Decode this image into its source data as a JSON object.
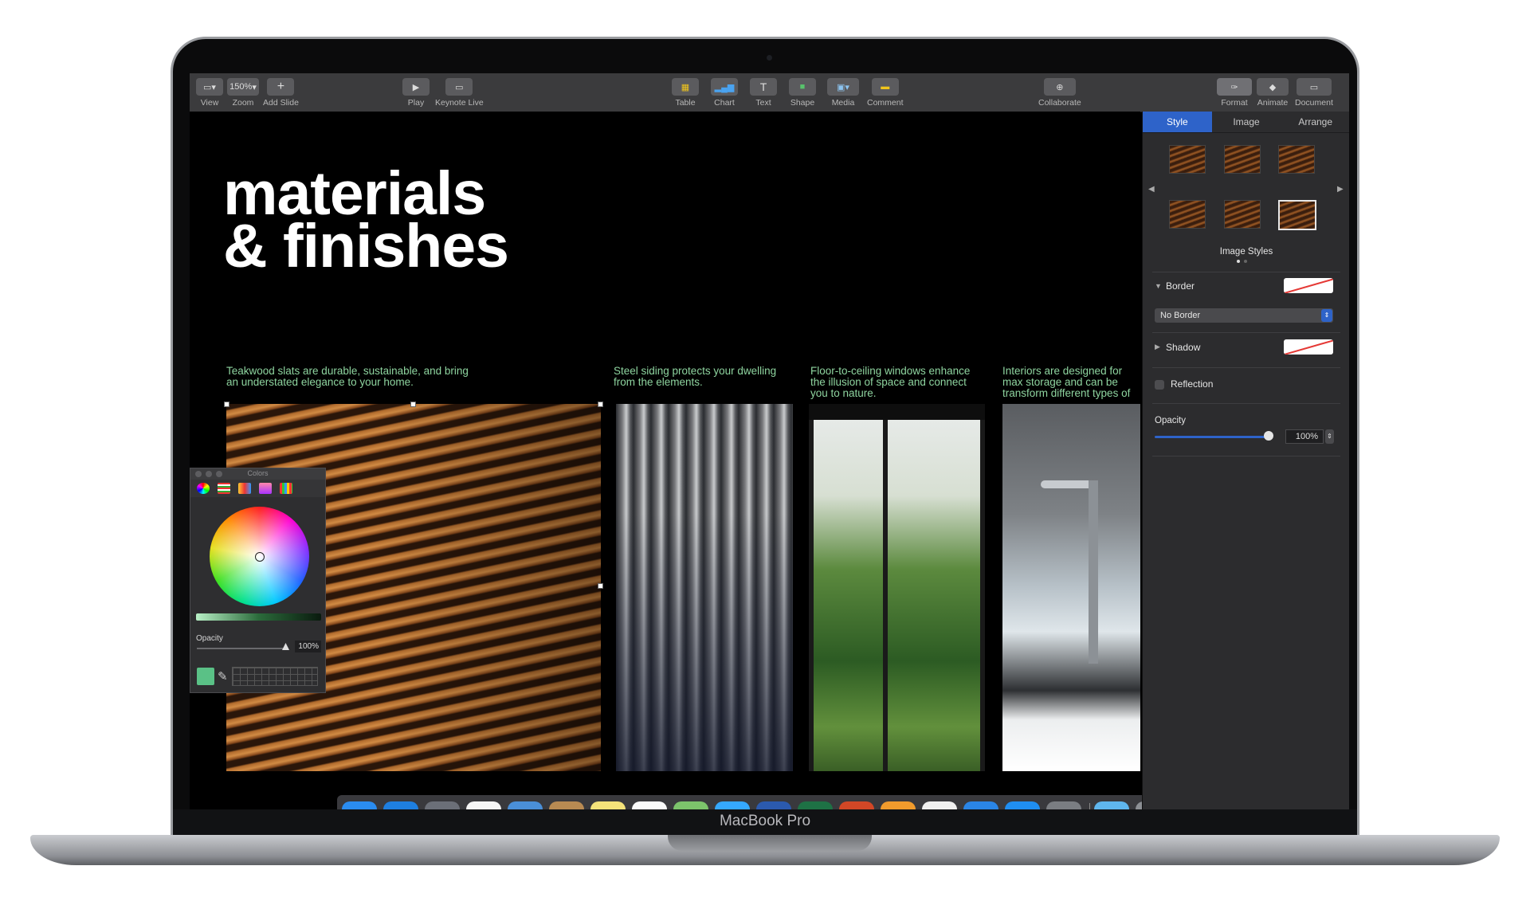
{
  "device_label": "MacBook Pro",
  "toolbar": {
    "left": [
      {
        "icon": "view-icon",
        "label": "View"
      },
      {
        "icon": "zoom-select",
        "value": "150%",
        "label": "Zoom"
      },
      {
        "icon": "plus-icon",
        "label": "Add Slide"
      }
    ],
    "play": [
      {
        "icon": "play-icon",
        "label": "Play"
      },
      {
        "icon": "keynote-live-icon",
        "label": "Keynote Live"
      }
    ],
    "insert": [
      {
        "icon": "table-icon",
        "label": "Table"
      },
      {
        "icon": "chart-icon",
        "label": "Chart"
      },
      {
        "icon": "text-icon",
        "label": "Text"
      },
      {
        "icon": "shape-icon",
        "label": "Shape"
      },
      {
        "icon": "media-icon",
        "label": "Media"
      },
      {
        "icon": "comment-icon",
        "label": "Comment"
      }
    ],
    "collaborate": {
      "icon": "collaborate-icon",
      "label": "Collaborate"
    },
    "right": [
      {
        "icon": "format-icon",
        "label": "Format"
      },
      {
        "icon": "animate-icon",
        "label": "Animate"
      },
      {
        "icon": "document-icon",
        "label": "Document"
      }
    ]
  },
  "slide": {
    "title_line1": "materials",
    "title_line2": "& finishes",
    "captions": [
      "Teakwood slats are durable, sustainable, and bring an understated elegance to your home.",
      "Steel siding protects your dwelling from the elements.",
      "Floor-to-ceiling windows enhance the illusion of space and connect you to nature.",
      "Interiors are designed for max storage and can be transform different types of spaces."
    ]
  },
  "inspector": {
    "tabs": [
      "Style",
      "Image",
      "Arrange"
    ],
    "selected_tab": "Style",
    "image_styles_label": "Image Styles",
    "border_label": "Border",
    "border_select": "No Border",
    "shadow_label": "Shadow",
    "reflection_label": "Reflection",
    "opacity_label": "Opacity",
    "opacity_value": "100%",
    "opacity_level": 1.0
  },
  "colors_panel": {
    "title": "Colors",
    "opacity_label": "Opacity",
    "opacity_value": "100%",
    "selected_color": "#5ac186"
  },
  "dock": {
    "apps": [
      {
        "name": "finder-icon",
        "glyph": "☺",
        "color": "#2a8cf0",
        "running": true
      },
      {
        "name": "safari-icon",
        "glyph": "⊕",
        "color": "#1e7fe0",
        "running": false
      },
      {
        "name": "launchpad-icon",
        "glyph": "➶",
        "color": "#6b6f78",
        "running": false
      },
      {
        "name": "photos-icon",
        "glyph": "✿",
        "color": "#f5f5f5",
        "running": false
      },
      {
        "name": "mail-icon",
        "glyph": "✉",
        "color": "#4a8fd8",
        "running": false
      },
      {
        "name": "contacts-icon",
        "glyph": "☗",
        "color": "#b88a52",
        "running": false
      },
      {
        "name": "notes-icon",
        "glyph": "✎",
        "color": "#f4e27a",
        "running": false
      },
      {
        "name": "reminders-icon",
        "glyph": "☰",
        "color": "#fafafa",
        "running": false
      },
      {
        "name": "maps-icon",
        "glyph": "⌖",
        "color": "#7cc36b",
        "running": false
      },
      {
        "name": "messages-icon",
        "glyph": "✆",
        "color": "#35a8ff",
        "running": false
      },
      {
        "name": "word-icon",
        "glyph": "W",
        "color": "#2b5aae",
        "running": false
      },
      {
        "name": "excel-icon",
        "glyph": "X",
        "color": "#1e7145",
        "running": false
      },
      {
        "name": "powerpoint-icon",
        "glyph": "P",
        "color": "#d24726",
        "running": false
      },
      {
        "name": "pages-icon",
        "glyph": "✐",
        "color": "#f19b2c",
        "running": false
      },
      {
        "name": "numbers-icon",
        "glyph": "▥",
        "color": "#f0f0f0",
        "running": false
      },
      {
        "name": "keynote-icon",
        "glyph": "⚲",
        "color": "#2a85e6",
        "running": true
      },
      {
        "name": "app-store-icon",
        "glyph": "A",
        "color": "#1f8ef1",
        "running": false
      },
      {
        "name": "system-preferences-icon",
        "glyph": "⚙",
        "color": "#7a7d82",
        "running": false
      },
      {
        "name": "downloads-folder-icon",
        "glyph": "⬇",
        "color": "#5fb6ee",
        "running": false
      },
      {
        "name": "trash-icon",
        "glyph": "🗑",
        "color": "#8c8f94",
        "running": false
      }
    ]
  }
}
